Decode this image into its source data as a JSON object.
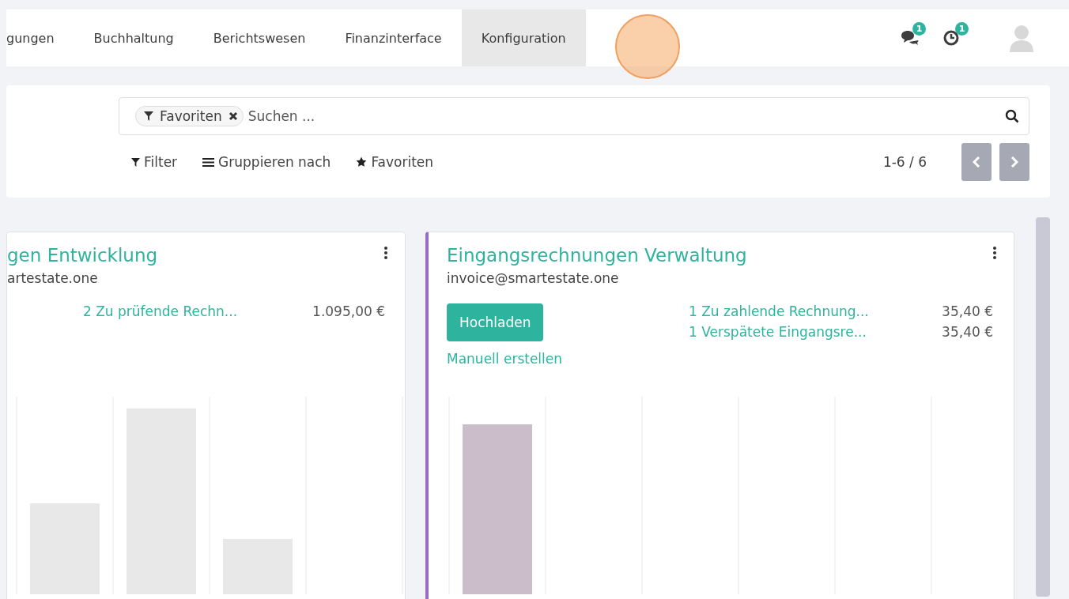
{
  "nav": {
    "menu": [
      {
        "label": "gungen",
        "selected": false
      },
      {
        "label": "Buchhaltung",
        "selected": false
      },
      {
        "label": "Berichtswesen",
        "selected": false
      },
      {
        "label": "Finanzinterface",
        "selected": false
      },
      {
        "label": "Konfiguration",
        "selected": true
      }
    ],
    "messages_badge": "1",
    "activities_badge": "1"
  },
  "control_panel": {
    "facet": "Favoriten",
    "placeholder": "Suchen ...",
    "filter": "Filter",
    "group_by": "Gruppieren nach",
    "favorites": "Favoriten",
    "pager": "1-6 / 6"
  },
  "cards": [
    {
      "title": "gen Entwicklung",
      "email": "artestate.one",
      "highlighted": false,
      "stats": [
        {
          "label": "2 Zu prüfende Rechn...",
          "amount": "1.095,00 €"
        }
      ]
    },
    {
      "title": "Eingangsrechnungen Verwaltung",
      "email": "invoice@smartestate.one",
      "highlighted": true,
      "upload_button": "Hochladen",
      "create_link": "Manuell erstellen",
      "stats": [
        {
          "label": "1 Zu zahlende Rechnung...",
          "amount": "35,40 €"
        },
        {
          "label": "1 Verspätete Eingangsre...",
          "amount": "35,40 €"
        }
      ]
    }
  ]
}
